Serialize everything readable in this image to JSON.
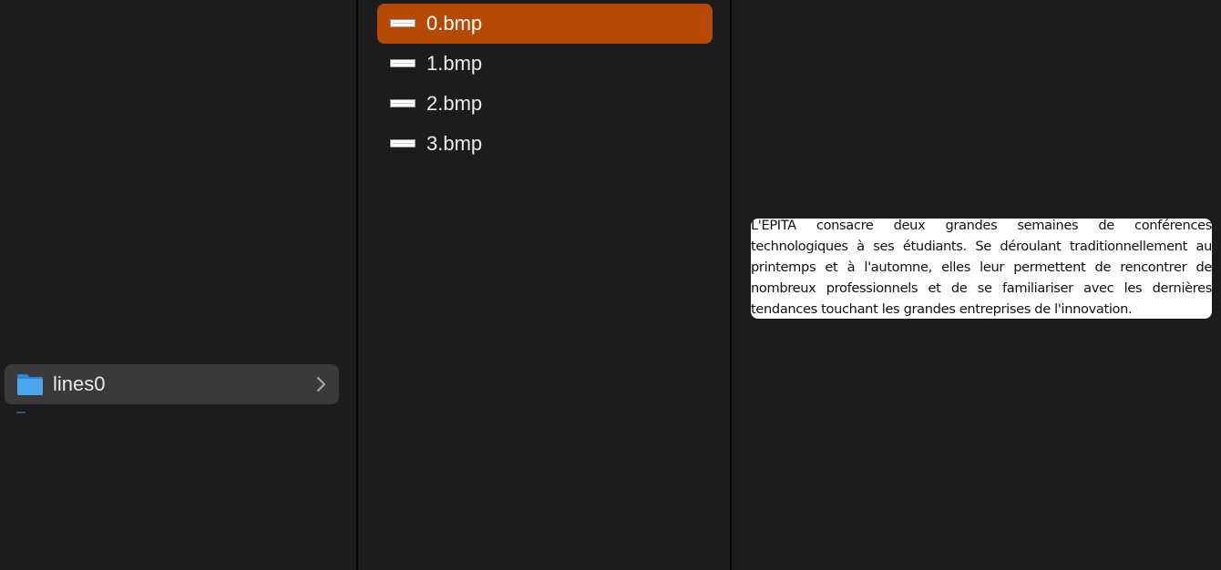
{
  "columns": {
    "parent": {
      "items": [
        {
          "label": "lines0",
          "icon": "folder-icon",
          "has_children": true,
          "highlighted": true
        }
      ]
    },
    "files": {
      "items": [
        {
          "label": "0.bmp",
          "icon": "image-file-icon",
          "selected": true
        },
        {
          "label": "1.bmp",
          "icon": "image-file-icon",
          "selected": false
        },
        {
          "label": "2.bmp",
          "icon": "image-file-icon",
          "selected": false
        },
        {
          "label": "3.bmp",
          "icon": "image-file-icon",
          "selected": false
        }
      ]
    },
    "preview": {
      "text": "L'EPITA consacre deux grandes semaines de conférences technologiques à ses étudiants. Se déroulant traditionnellement au printemps et à l'automne, elles leur permettent de rencontrer de nombreux professionnels et de se familiariser avec les dernières tendances touchant les grandes entreprises de l'innovation."
    }
  },
  "colors": {
    "background": "#1c1c1c",
    "selection": "#b64a05",
    "folder_row_highlight": "#3a3a3a",
    "folder_blue": "#3a9be6"
  }
}
